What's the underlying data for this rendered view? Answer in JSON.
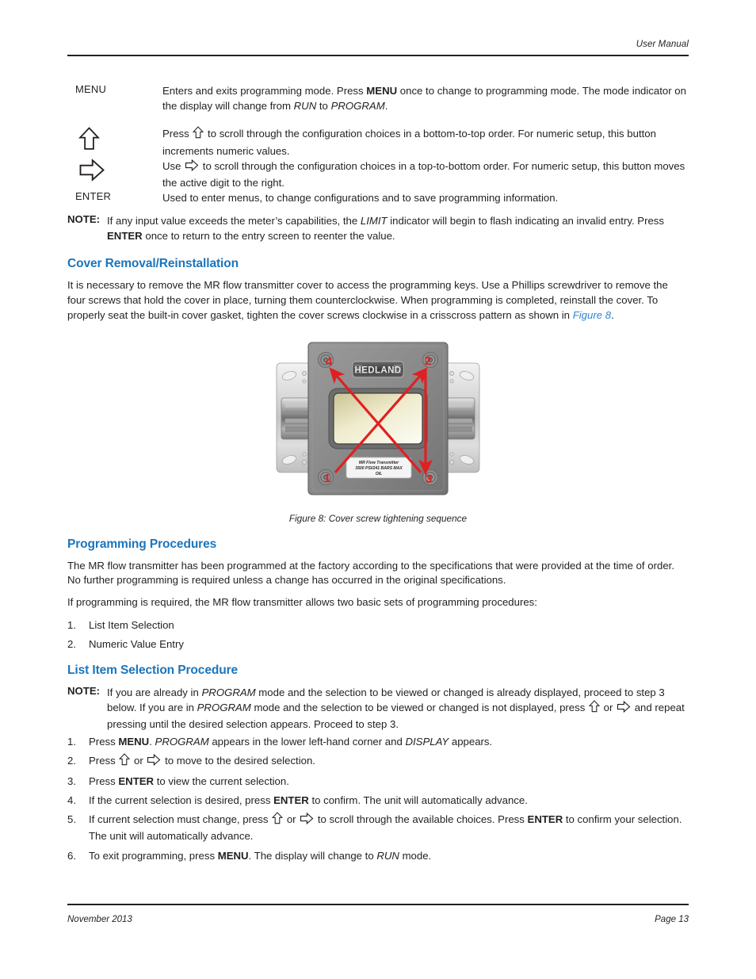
{
  "header": {
    "right_text": "User Manual"
  },
  "footer": {
    "left_text": "November 2013",
    "right_text": "Page 13"
  },
  "colors": {
    "heading_blue": "#1b75bc",
    "link_blue": "#2b87d4",
    "body_text": "#231f20",
    "arrow_red": "#e02020",
    "device_body": "#8c8c8c",
    "display_cream": "#e8e4c8"
  },
  "key_table": {
    "rows": [
      {
        "label": "MENU",
        "label_kind": "text",
        "desc_parts": [
          {
            "t": "Enters and exits programming mode. Press ",
            "s": "normal"
          },
          {
            "t": "MENU",
            "s": "bold"
          },
          {
            "t": " once to change to programming mode. The mode indicator on the display will change from ",
            "s": "normal"
          },
          {
            "t": "RUN",
            "s": "italic"
          },
          {
            "t": " to ",
            "s": "normal"
          },
          {
            "t": "PROGRAM",
            "s": "italic"
          },
          {
            "t": ".",
            "s": "normal"
          }
        ]
      },
      {
        "label": "up-arrow-icon",
        "label_kind": "icon-up",
        "desc_parts": [
          {
            "t": "Press ",
            "s": "normal"
          },
          {
            "t": "up-arrow-icon",
            "s": "icon-up"
          },
          {
            "t": " to scroll through the configuration choices in a bottom-to-top order. For numeric setup, this button increments numeric values.",
            "s": "normal"
          }
        ]
      },
      {
        "label": "right-arrow-icon",
        "label_kind": "icon-right",
        "desc_parts": [
          {
            "t": "Use ",
            "s": "normal"
          },
          {
            "t": "right-arrow-icon",
            "s": "icon-right"
          },
          {
            "t": " to scroll through the configuration choices in a top-to-bottom order. For numeric setup, this button moves the active digit to the right.",
            "s": "normal"
          }
        ]
      },
      {
        "label": "ENTER",
        "label_kind": "text",
        "desc_parts": [
          {
            "t": "Used to enter menus, to change configurations and to save programming information.",
            "s": "normal"
          }
        ]
      }
    ]
  },
  "note_top": {
    "tag": "NOTE:",
    "parts": [
      {
        "t": "If any input value exceeds the meter’s capabilities, the ",
        "s": "normal"
      },
      {
        "t": "LIMIT",
        "s": "italic"
      },
      {
        "t": " indicator will begin to flash indicating an invalid entry. Press ",
        "s": "normal"
      },
      {
        "t": "ENTER",
        "s": "bold"
      },
      {
        "t": " once to return to the entry screen to reenter the value.",
        "s": "normal"
      }
    ]
  },
  "section_cover": {
    "heading": "Cover Removal/Reinstallation",
    "paragraph_parts": [
      {
        "t": "It is necessary to remove the MR flow transmitter cover to access the programming keys. Use a Phillips screwdriver to remove the four screws that hold the cover in place, turning them counterclockwise. When programming is completed, reinstall the cover. To properly seat the built-in cover gasket, tighten the cover screws clockwise in a crisscross pattern as shown in ",
        "s": "normal"
      },
      {
        "t": "Figure 8",
        "s": "link"
      },
      {
        "t": ".",
        "s": "normal"
      }
    ]
  },
  "figure": {
    "caption": "Figure 8:  Cover screw tightening sequence",
    "device": {
      "brand": "HEDLAND",
      "nameplate_lines": [
        "MR Flow Transmitter",
        "3500 PSI/241 BARS MAX",
        "OIL"
      ],
      "sequence_labels": [
        "1",
        "2",
        "3",
        "4"
      ],
      "screw_count": 4
    }
  },
  "section_programming": {
    "heading": "Programming Procedures",
    "paragraph_1": "The MR flow transmitter has been programmed at the factory according to the specifications that were provided at the time of order. No further programming is required unless a change has occurred in the original specifications.",
    "paragraph_2": "If programming is required, the MR flow transmitter allows two basic sets of programming procedures:",
    "list": [
      {
        "n": "1.",
        "text": "List Item Selection"
      },
      {
        "n": "2.",
        "text": "Numeric Value Entry"
      }
    ]
  },
  "section_list_item": {
    "heading": "List Item Selection Procedure",
    "note": {
      "tag": "NOTE:",
      "parts": [
        {
          "t": "If you are already in ",
          "s": "normal"
        },
        {
          "t": "PROGRAM",
          "s": "italic"
        },
        {
          "t": " mode and the selection to be viewed or changed is already displayed, proceed to step 3 below. If you are in ",
          "s": "normal"
        },
        {
          "t": "PROGRAM",
          "s": "italic"
        },
        {
          "t": " mode and the selection to be viewed or changed is not displayed, press ",
          "s": "normal"
        },
        {
          "t": "up-arrow-icon",
          "s": "icon-up"
        },
        {
          "t": " or ",
          "s": "normal"
        },
        {
          "t": "right-arrow-icon",
          "s": "icon-right"
        },
        {
          "t": " and repeat pressing until the desired selection appears. Proceed to step 3.",
          "s": "normal"
        }
      ]
    },
    "steps": [
      {
        "n": "1.",
        "parts": [
          {
            "t": "Press ",
            "s": "normal"
          },
          {
            "t": "MENU",
            "s": "bold"
          },
          {
            "t": ". ",
            "s": "normal"
          },
          {
            "t": "PROGRAM",
            "s": "italic"
          },
          {
            "t": " appears in the lower left-hand corner and ",
            "s": "normal"
          },
          {
            "t": "DISPLAY",
            "s": "italic"
          },
          {
            "t": " appears.",
            "s": "normal"
          }
        ]
      },
      {
        "n": "2.",
        "parts": [
          {
            "t": "Press ",
            "s": "normal"
          },
          {
            "t": "up-arrow-icon",
            "s": "icon-up"
          },
          {
            "t": " or ",
            "s": "normal"
          },
          {
            "t": "right-arrow-icon",
            "s": "icon-right"
          },
          {
            "t": " to move to the desired selection.",
            "s": "normal"
          }
        ]
      },
      {
        "n": "3.",
        "parts": [
          {
            "t": "Press ",
            "s": "normal"
          },
          {
            "t": "ENTER",
            "s": "bold"
          },
          {
            "t": " to view the current selection.",
            "s": "normal"
          }
        ]
      },
      {
        "n": "4.",
        "parts": [
          {
            "t": "If the current selection is desired, press ",
            "s": "normal"
          },
          {
            "t": "ENTER",
            "s": "bold"
          },
          {
            "t": " to confirm. The unit will automatically advance.",
            "s": "normal"
          }
        ]
      },
      {
        "n": "5.",
        "parts": [
          {
            "t": "If current selection must change, press ",
            "s": "normal"
          },
          {
            "t": "up-arrow-icon",
            "s": "icon-up"
          },
          {
            "t": " or ",
            "s": "normal"
          },
          {
            "t": "right-arrow-icon",
            "s": "icon-right"
          },
          {
            "t": " to scroll through the available choices. Press ",
            "s": "normal"
          },
          {
            "t": "ENTER",
            "s": "bold"
          },
          {
            "t": " to confirm your selection. The unit will automatically advance.",
            "s": "normal"
          }
        ]
      },
      {
        "n": "6.",
        "parts": [
          {
            "t": "To exit programming, press ",
            "s": "normal"
          },
          {
            "t": "MENU",
            "s": "bold"
          },
          {
            "t": ". The display will change to ",
            "s": "normal"
          },
          {
            "t": "RUN",
            "s": "italic"
          },
          {
            "t": " mode.",
            "s": "normal"
          }
        ]
      }
    ]
  }
}
